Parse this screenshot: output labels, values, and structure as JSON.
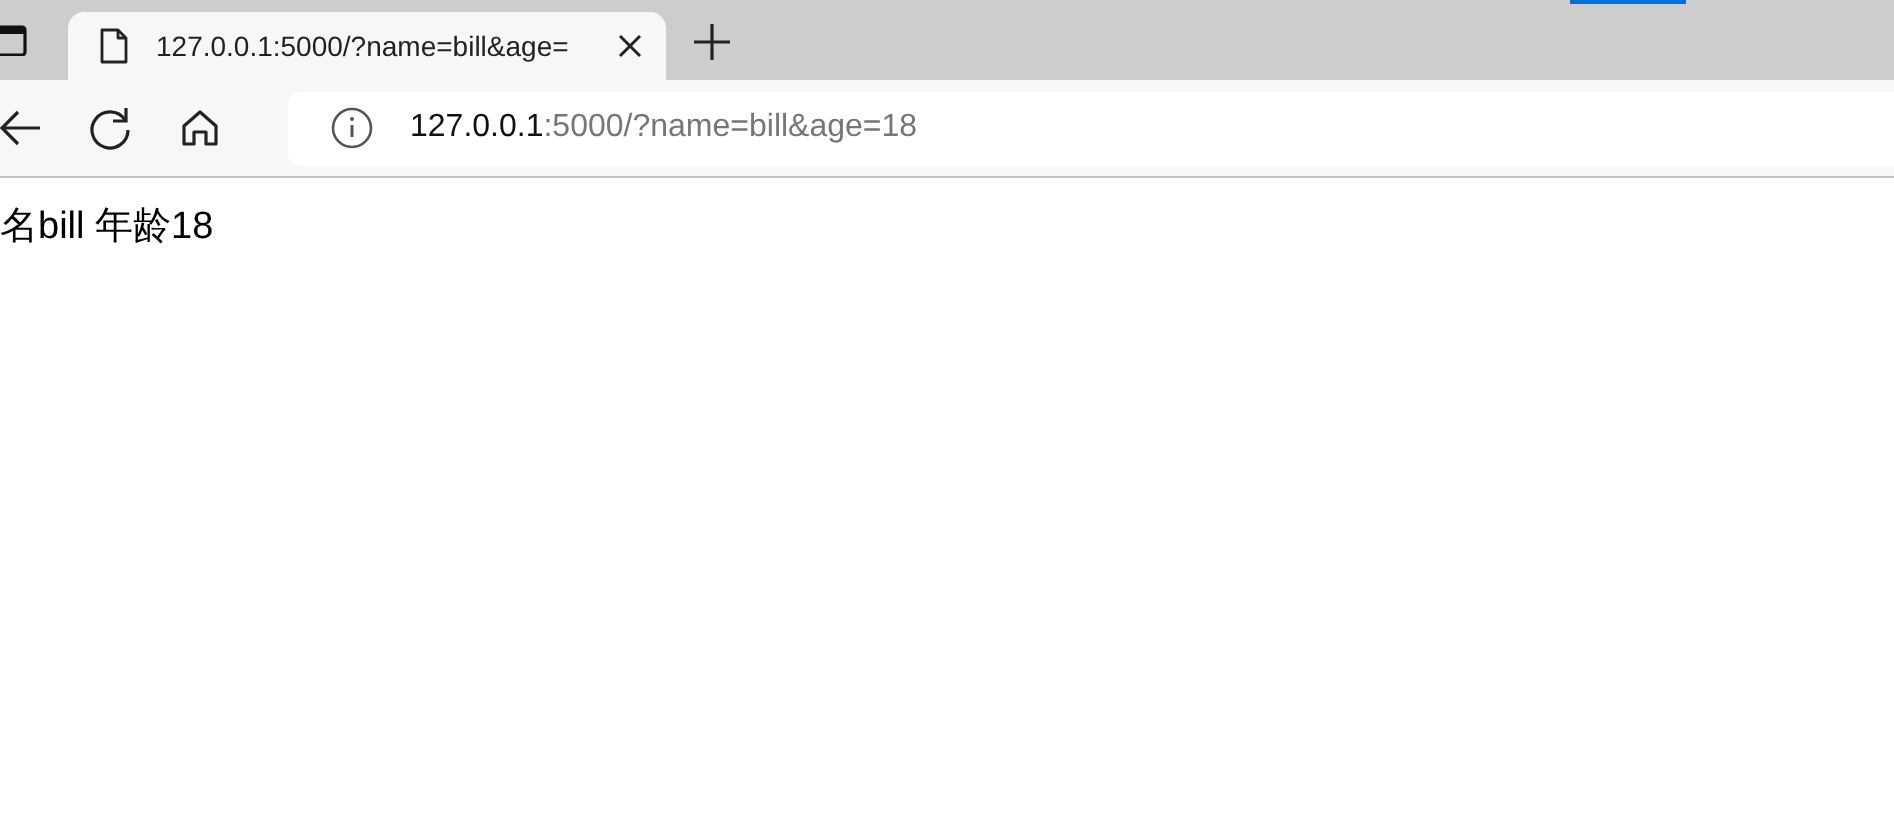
{
  "tabs": [
    {
      "title": "127.0.0.1:5000/?name=bill&age=",
      "selected": true
    }
  ],
  "address_bar": {
    "host": "127.0.0.1",
    "path": ":5000/?name=bill&age=18"
  },
  "page": {
    "text": "名bill 年龄18"
  }
}
